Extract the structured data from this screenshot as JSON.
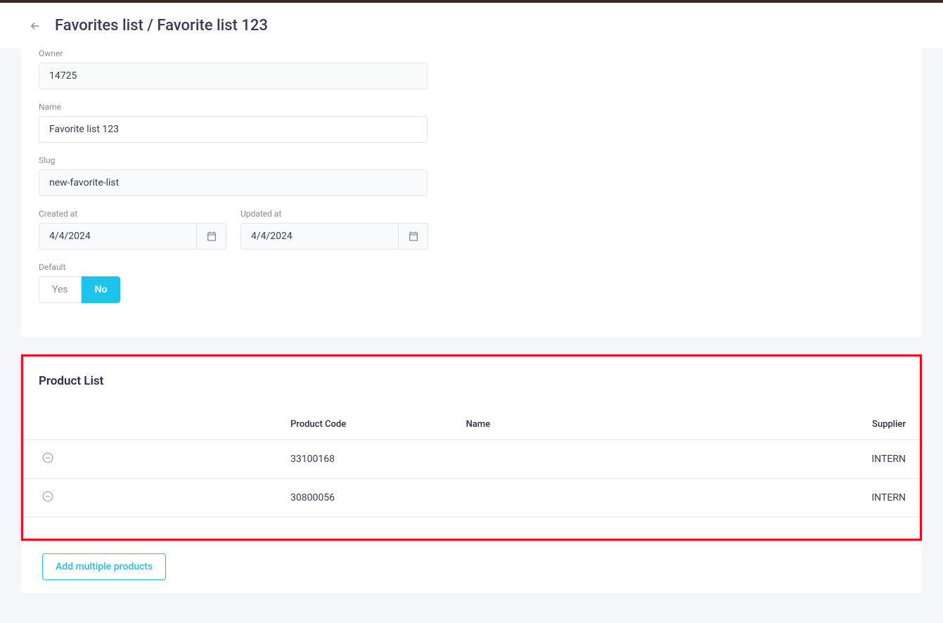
{
  "breadcrumb": "Favorites list / Favorite list 123",
  "form": {
    "owner_label": "Owner",
    "owner_value": "14725",
    "name_label": "Name",
    "name_value": "Favorite list 123",
    "slug_label": "Slug",
    "slug_value": "new-favorite-list",
    "created_label": "Created at",
    "created_value": "4/4/2024",
    "updated_label": "Updated at",
    "updated_value": "4/4/2024",
    "default_label": "Default",
    "default_yes": "Yes",
    "default_no": "No"
  },
  "product_list": {
    "title": "Product List",
    "columns": {
      "product_code": "Product Code",
      "name": "Name",
      "supplier": "Supplier"
    },
    "rows": [
      {
        "product_code": "33100168",
        "name": "",
        "supplier": "INTERN"
      },
      {
        "product_code": "30800056",
        "name": "",
        "supplier": "INTERN"
      }
    ]
  },
  "add_button": "Add multiple products"
}
